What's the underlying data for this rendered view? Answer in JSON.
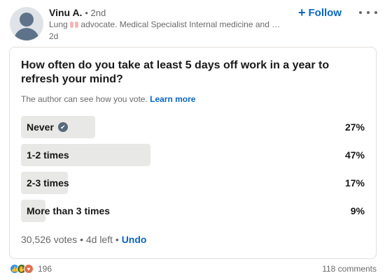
{
  "author": {
    "name": "Vinu A.",
    "degree": "2nd",
    "headline_before": "Lung",
    "headline_after": "advocate. Medical Specialist Internal medicine and …",
    "time": "2d"
  },
  "actions": {
    "follow_label": "Follow",
    "follow_icon": "+"
  },
  "poll": {
    "question": "How often do you take at least 5 days off work in a year to refresh your mind?",
    "privacy_text": "The author can see how you vote.",
    "learn_more_label": "Learn more",
    "options": [
      {
        "label": "Never",
        "percent": "27%",
        "fraction": 0.27,
        "selected": true
      },
      {
        "label": "1-2 times",
        "percent": "47%",
        "fraction": 0.47,
        "selected": false
      },
      {
        "label": "2-3 times",
        "percent": "17%",
        "fraction": 0.17,
        "selected": false
      },
      {
        "label": "More than 3 times",
        "percent": "9%",
        "fraction": 0.09,
        "selected": false
      }
    ],
    "votes": "30,526 votes",
    "time_left": "4d left",
    "undo_label": "Undo"
  },
  "social": {
    "reaction_icons": [
      "like-icon",
      "celebrate-icon",
      "love-icon"
    ],
    "reaction_count": "196",
    "comments": "118 comments"
  },
  "colors": {
    "accent": "#0a66c2",
    "bar": "#e8e8e6",
    "check": "#56687a"
  }
}
